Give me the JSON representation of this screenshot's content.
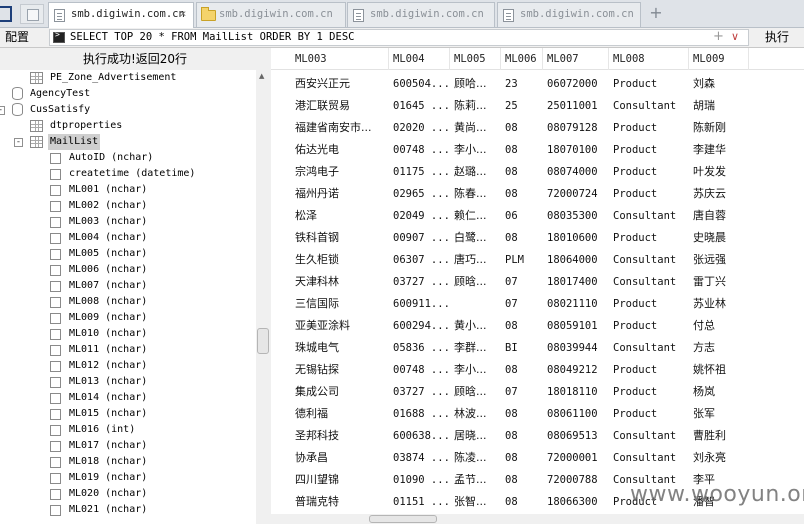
{
  "tabs": [
    {
      "label": "smb.digiwin.com.cn",
      "icon": "file-icon",
      "active": true
    },
    {
      "label": "smb.digiwin.com.cn",
      "icon": "folder-icon",
      "active": false
    },
    {
      "label": "smb.digiwin.com.cn",
      "icon": "file-icon",
      "active": false
    },
    {
      "label": "smb.digiwin.com.cn",
      "icon": "file-icon",
      "active": false
    }
  ],
  "add_tab_label": "+",
  "toolbar": {
    "config_label": "配置",
    "sql": "SELECT TOP 20 * FROM MailList ORDER BY 1 DESC",
    "plus_label": "+",
    "dropdown_label": "∨",
    "execute_label": "执行"
  },
  "status": "执行成功!返回20行",
  "tree": [
    {
      "label": "PE_Zone_Advertisement",
      "icon": "table"
    },
    {
      "label": "AgencyTest",
      "icon": "database"
    },
    {
      "label": "CusSatisfy",
      "icon": "database",
      "expander": "-"
    },
    {
      "label": "dtproperties",
      "icon": "table"
    },
    {
      "label": "MailList",
      "icon": "table",
      "expander": "-",
      "selected": true
    },
    {
      "label": "AutoID (nchar)",
      "icon": "column"
    },
    {
      "label": "createtime (datetime)",
      "icon": "column"
    },
    {
      "label": "ML001 (nchar)",
      "icon": "column"
    },
    {
      "label": "ML002 (nchar)",
      "icon": "column"
    },
    {
      "label": "ML003 (nchar)",
      "icon": "column"
    },
    {
      "label": "ML004 (nchar)",
      "icon": "column"
    },
    {
      "label": "ML005 (nchar)",
      "icon": "column"
    },
    {
      "label": "ML006 (nchar)",
      "icon": "column"
    },
    {
      "label": "ML007 (nchar)",
      "icon": "column"
    },
    {
      "label": "ML008 (nchar)",
      "icon": "column"
    },
    {
      "label": "ML009 (nchar)",
      "icon": "column"
    },
    {
      "label": "ML010 (nchar)",
      "icon": "column"
    },
    {
      "label": "ML011 (nchar)",
      "icon": "column"
    },
    {
      "label": "ML012 (nchar)",
      "icon": "column"
    },
    {
      "label": "ML013 (nchar)",
      "icon": "column"
    },
    {
      "label": "ML014 (nchar)",
      "icon": "column"
    },
    {
      "label": "ML015 (nchar)",
      "icon": "column"
    },
    {
      "label": "ML016 (int)",
      "icon": "column"
    },
    {
      "label": "ML017 (nchar)",
      "icon": "column"
    },
    {
      "label": "ML018 (nchar)",
      "icon": "column"
    },
    {
      "label": "ML019 (nchar)",
      "icon": "column"
    },
    {
      "label": "ML020 (nchar)",
      "icon": "column"
    },
    {
      "label": "ML021 (nchar)",
      "icon": "column"
    }
  ],
  "grid": {
    "columns": [
      "ML003",
      "ML004",
      "ML005",
      "ML006",
      "ML007",
      "ML008",
      "ML009"
    ],
    "rows": [
      [
        "西安兴正元",
        "600504...",
        "顾哈...",
        "23",
        "06072000",
        "Product",
        "刘森"
      ],
      [
        "港汇联贸易",
        "01645 ...",
        "陈莉...",
        "25",
        "25011001",
        "Consultant",
        "胡瑞"
      ],
      [
        "福建省南安市...",
        "02020 ...",
        "黄尚...",
        "08",
        "08079128",
        "Product",
        "陈新刚"
      ],
      [
        "佑达光电",
        "00748 ...",
        "李小...",
        "08",
        "18070100",
        "Product",
        "李建华"
      ],
      [
        "宗鸿电子",
        "01175 ...",
        "赵璐...",
        "08",
        "08074000",
        "Product",
        "叶发发"
      ],
      [
        "福州丹诺",
        "02965 ...",
        "陈春...",
        "08",
        "72000724",
        "Product",
        "苏庆云"
      ],
      [
        "松泽",
        "02049 ...",
        "赖仁...",
        "06",
        "08035300",
        "Consultant",
        "唐自蓉"
      ],
      [
        "铁科首钢",
        "00907 ...",
        "白鹭...",
        "08",
        "18010600",
        "Product",
        "史晓晨"
      ],
      [
        "生久柜锁",
        "06307 ...",
        "唐巧...",
        "PLM",
        "18064000",
        "Consultant",
        "张远强"
      ],
      [
        "天津科林",
        "03727 ...",
        "顾晗...",
        "07",
        "18017400",
        "Consultant",
        "雷丁兴"
      ],
      [
        "三信国际",
        "600911...",
        "",
        "07",
        "08021110",
        "Product",
        "苏业林"
      ],
      [
        "亚美亚涂料",
        "600294...",
        "黄小...",
        "08",
        "08059101",
        "Product",
        "付总"
      ],
      [
        "珠城电气",
        "05836 ...",
        "李群...",
        "BI",
        "08039944",
        "Consultant",
        "方志"
      ],
      [
        "无锡钻探",
        "00748 ...",
        "李小...",
        "08",
        "08049212",
        "Product",
        "姚怀祖"
      ],
      [
        "集成公司",
        "03727 ...",
        "顾晗...",
        "07",
        "18018110",
        "Product",
        "杨岚"
      ],
      [
        "德利福",
        "01688 ...",
        "林波...",
        "08",
        "08061100",
        "Product",
        "张军"
      ],
      [
        "圣邦科技",
        "600638...",
        "居晓...",
        "08",
        "08069513",
        "Consultant",
        "曹胜利"
      ],
      [
        "协承昌",
        "03874 ...",
        "陈凌...",
        "08",
        "72000001",
        "Consultant",
        "刘永亮"
      ],
      [
        "四川望锦",
        "01090 ...",
        "孟节...",
        "08",
        "72000788",
        "Consultant",
        "李平"
      ],
      [
        "普瑞克特",
        "01151 ...",
        "张智...",
        "08",
        "18066300",
        "Product",
        "潘智"
      ]
    ]
  },
  "watermark": "www.wooyun.org"
}
